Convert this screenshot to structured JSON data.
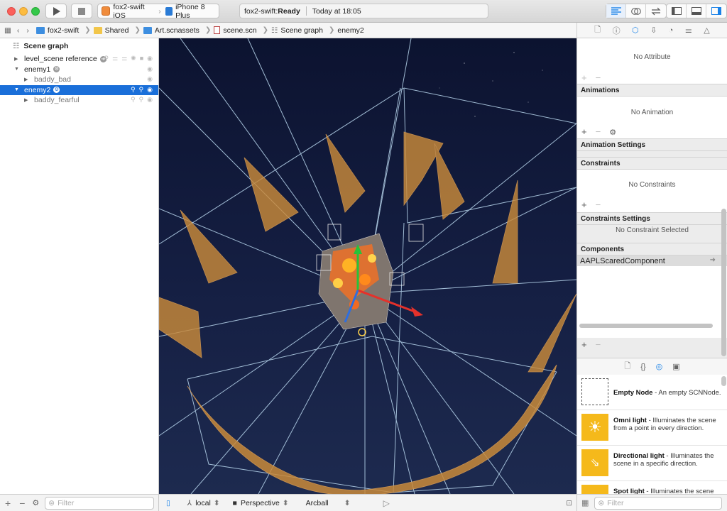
{
  "toolbar": {
    "scheme_app": "fox2-swift iOS",
    "scheme_device": "iPhone 8 Plus",
    "activity_project": "fox2-swift: ",
    "activity_status": "Ready",
    "activity_time": "Today at 18:05"
  },
  "jumpbar": {
    "items": [
      "fox2-swift",
      "Shared",
      "Art.scnassets",
      "scene.scn",
      "Scene graph",
      "enemy2"
    ]
  },
  "outline": {
    "header": "Scene graph",
    "rows": [
      {
        "label": "level_scene reference"
      },
      {
        "label": "enemy1"
      },
      {
        "label": "baddy_bad"
      },
      {
        "label": "enemy2"
      },
      {
        "label": "baddy_fearful"
      }
    ],
    "filter_placeholder": "Filter"
  },
  "viewport_footer": {
    "space": "local",
    "camera": "Perspective",
    "navigation": "Arcball"
  },
  "inspector": {
    "attributes_empty": "No Attribute",
    "animations_title": "Animations",
    "animations_empty": "No Animation",
    "animation_settings_title": "Animation Settings",
    "constraints_title": "Constraints",
    "constraints_empty": "No Constraints",
    "constraints_settings_title": "Constraints Settings",
    "constraints_settings_empty": "No Constraint Selected",
    "components_title": "Components",
    "components": [
      "AAPLScaredComponent"
    ]
  },
  "library": {
    "items": [
      {
        "name": "Empty Node",
        "desc": " - An empty SCNNode."
      },
      {
        "name": "Omni light",
        "desc": " - Illuminates the scene from a point in every direction."
      },
      {
        "name": "Directional light",
        "desc": " - Illuminates the scene in a specific direction."
      },
      {
        "name": "Spot light",
        "desc": " - Illuminates the scene"
      }
    ],
    "filter_placeholder": "Filter"
  },
  "colors": {
    "selection": "#1a6fd9",
    "accent": "#1a82e8",
    "light_icon": "#f5b91b",
    "terrain": "#c98a3a"
  }
}
